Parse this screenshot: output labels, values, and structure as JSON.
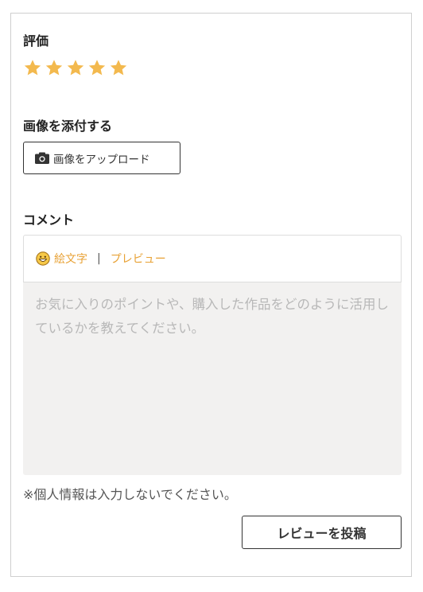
{
  "rating": {
    "title": "評価",
    "max_stars": 5,
    "selected_stars": 5,
    "star_color": "#f3b94e"
  },
  "attach": {
    "title": "画像を添付する",
    "upload_label": "画像をアップロード",
    "upload_icon": "camera-icon"
  },
  "comment": {
    "title": "コメント",
    "toolbar": {
      "emoji_icon": "smile-icon",
      "emoji_label": "絵文字",
      "separator": "|",
      "preview_label": "プレビュー"
    },
    "placeholder": "お気に入りのポイントや、購入した作品をどのように活用しているかを教えてください。",
    "value": ""
  },
  "notice": "※個人情報は入力しないでください。",
  "submit_label": "レビューを投稿",
  "colors": {
    "accent": "#e8a236",
    "textarea_bg": "#f2f1f0",
    "border": "#cfcfcf"
  }
}
